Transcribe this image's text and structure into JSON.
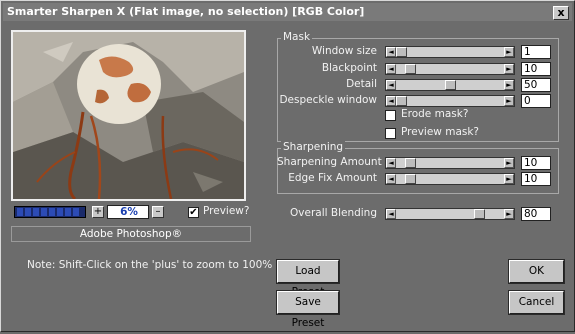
{
  "window": {
    "title": "Smarter Sharpen X (Flat image, no selection) [RGB Color]",
    "close_glyph": "x"
  },
  "preview": {
    "zoom": "6%",
    "zoom_minus": "–",
    "zoom_plus": "+",
    "preview_label": "Preview?",
    "preview_checked": true,
    "progress_fraction": 1.0
  },
  "adobe_label": "Adobe Photoshop®",
  "note": "Note: Shift-Click on the 'plus' to zoom to 100%",
  "mask": {
    "group_label": "Mask",
    "window_size": {
      "label": "Window size",
      "value": "1",
      "fraction": 0.0
    },
    "blackpoint": {
      "label": "Blackpoint",
      "value": "10",
      "fraction": 0.1
    },
    "detail": {
      "label": "Detail",
      "value": "50",
      "fraction": 0.5
    },
    "despeckle": {
      "label": "Despeckle window",
      "value": "0",
      "fraction": 0.0
    },
    "erode_label": "Erode mask?",
    "preview_mask_label": "Preview mask?"
  },
  "sharpening": {
    "group_label": "Sharpening",
    "amount": {
      "label": "Sharpening Amount",
      "value": "10",
      "fraction": 0.1
    },
    "edge_fix": {
      "label": "Edge Fix Amount",
      "value": "10",
      "fraction": 0.1
    }
  },
  "overall": {
    "label": "Overall Blending",
    "value": "80",
    "fraction": 0.8
  },
  "buttons": {
    "load_preset": "Load Preset",
    "save_preset": "Save Preset",
    "ok": "OK",
    "cancel": "Cancel"
  },
  "icons": {
    "arrow_left": "◄",
    "arrow_right": "►",
    "check": "✔"
  }
}
